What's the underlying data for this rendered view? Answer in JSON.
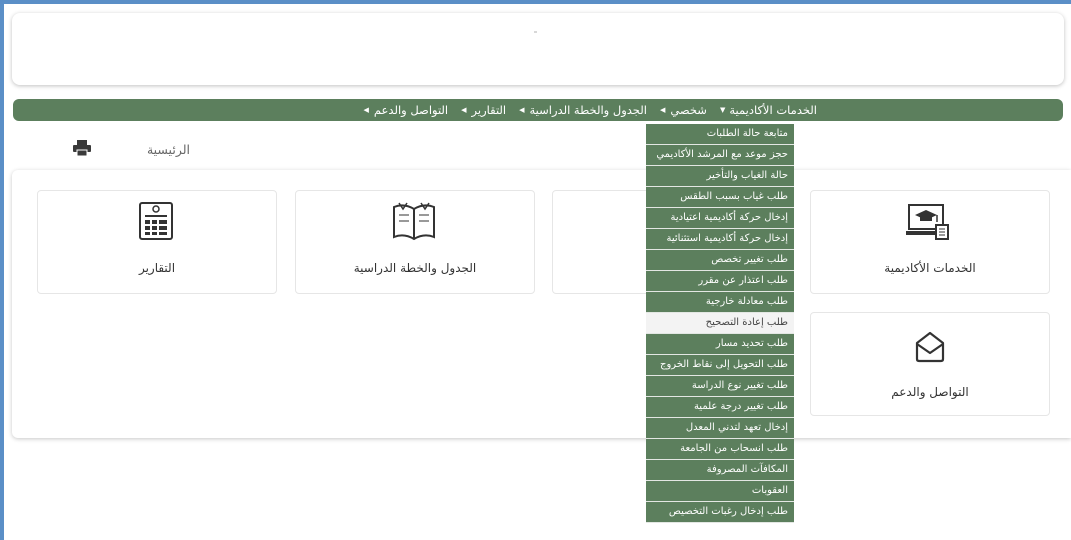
{
  "navbar": {
    "items": [
      {
        "label": "الخدمات الأكاديمية",
        "has_caret": true
      },
      {
        "label": "شخصي",
        "has_caret": false
      },
      {
        "label": "الجدول والخطة الدراسية",
        "has_caret": false
      },
      {
        "label": "التقارير",
        "has_caret": false
      },
      {
        "label": "التواصل والدعم",
        "has_caret": false
      }
    ],
    "caret_glyph": "▼",
    "arrow_glyph": "◀"
  },
  "breadcrumb": {
    "title": "الرئيسية"
  },
  "icons": {
    "print": "printer-icon"
  },
  "tiles": {
    "academic_services": "الخدمات الأكاديمية",
    "schedule_plan": "الجدول والخطة الدراسية",
    "reports": "التقارير",
    "communication_support": "التواصل والدعم"
  },
  "dropdown": {
    "items": [
      "متابعة حالة الطلبات",
      "حجز موعد مع المرشد الأكاديمي",
      "حالة الغياب والتأخير",
      "طلب غياب بسبب الطقس",
      "إدخال حركة أكاديمية اعتيادية",
      "إدخال حركة أكاديمية استثنائية",
      "طلب تغيير تخصص",
      "طلب اعتذار عن مقرر",
      "طلب معادلة خارجية",
      "طلب إعادة التصحيح",
      "طلب تحديد مسار",
      "طلب التحويل إلى نقاط الخروج",
      "طلب تغيير نوع الدراسة",
      "طلب تغيير درجة علمية",
      "إدخال تعهد لتدني المعدل",
      "طلب انسحاب من الجامعة",
      "المكافآت المصروفة",
      "العقوبات",
      "طلب إدخال رغبات التخصيص"
    ],
    "active_index": 9
  },
  "colors": {
    "brand_green": "#5c7f5d",
    "frame_blue": "#5b8fc7"
  }
}
